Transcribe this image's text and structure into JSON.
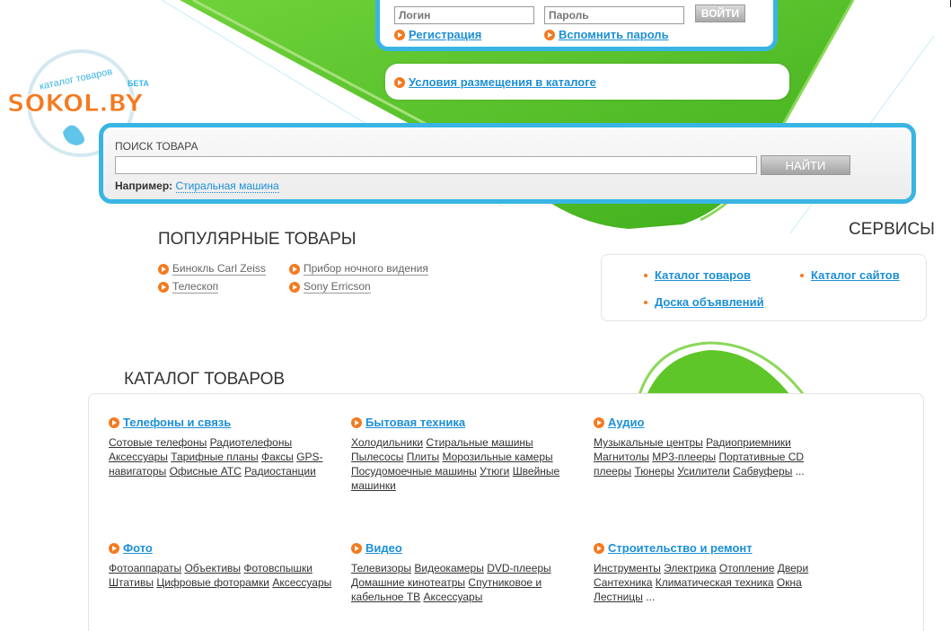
{
  "login": {
    "login_placeholder": "Логин",
    "password_placeholder": "Пароль",
    "submit_label": "ВОЙТИ",
    "register_link": "Регистрация",
    "forgot_link": "Вспомнить пароль"
  },
  "terms_link": "Условия размещения в каталоге",
  "logo": {
    "brand": "SOKOL.BY",
    "tagline": "каталог товаров",
    "badge": "БЕТА"
  },
  "search": {
    "label": "ПОИСК ТОВАРА",
    "button": "НАЙТИ",
    "example_label": "Например:",
    "example_link": "Стиральная машина"
  },
  "popular": {
    "title": "ПОПУЛЯРНЫЕ ТОВАРЫ",
    "items": [
      "Бинокль Carl Zeiss",
      "Прибор ночного видения",
      "Телескоп",
      "Sony Erricson"
    ]
  },
  "services": {
    "title": "СЕРВИСЫ",
    "items": [
      "Каталог товаров",
      "Каталог сайтов",
      "Доска объявлений"
    ]
  },
  "catalog": {
    "title": "КАТАЛОГ ТОВАРОВ",
    "categories": [
      {
        "name": "Телефоны и связь",
        "subs": [
          "Сотовые телефоны",
          "Радиотелефоны",
          "Аксессуары",
          "Тарифные планы",
          "Факсы",
          "GPS-навигаторы",
          "Офисные АТС",
          "Радиостанции"
        ],
        "more": ""
      },
      {
        "name": "Бытовая техника",
        "subs": [
          "Холодильники",
          "Стиральные машины",
          "Пылесосы",
          "Плиты",
          "Морозильные камеры",
          "Посудомоечные машины",
          "Утюги",
          "Швейные машинки"
        ],
        "more": ""
      },
      {
        "name": "Аудио",
        "subs": [
          "Музыкальные центры",
          "Радиоприемники",
          "Магнитолы",
          "MP3-плееры",
          "Портативные CD плееры",
          "Тюнеры",
          "Усилители",
          "Сабвуферы"
        ],
        "more": "..."
      },
      {
        "name": "Фото",
        "subs": [
          "Фотоаппараты",
          "Объективы",
          "Фотовспышки",
          "Штативы",
          "Цифровые фоторамки",
          "Аксессуары"
        ],
        "more": ""
      },
      {
        "name": "Видео",
        "subs": [
          "Телевизоры",
          "Видеокамеры",
          "DVD-плееры",
          "Домашние кинотеатры",
          "Спутниковое и кабельное ТВ",
          "Аксессуары"
        ],
        "more": ""
      },
      {
        "name": "Строительство и ремонт",
        "subs": [
          "Инструменты",
          "Электрика",
          "Отопление",
          "Двери",
          "Сантехника",
          "Климатическая техника",
          "Окна",
          "Лестницы"
        ],
        "more": "..."
      }
    ]
  },
  "colors": {
    "accent": "#39b5e3",
    "green": "#5fc629",
    "link": "#1c8fd6",
    "bullet": "#f47a20"
  }
}
